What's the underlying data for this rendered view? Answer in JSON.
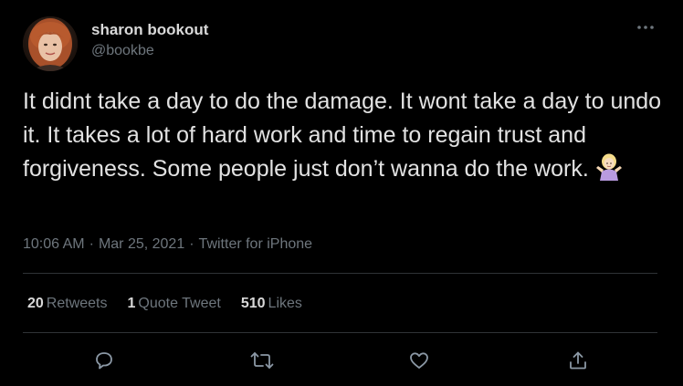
{
  "author": {
    "display_name": "sharon bookout",
    "handle": "@bookbe",
    "avatar_icon": "user-avatar-photo"
  },
  "tweet": {
    "text": "It didnt take a day to do the damage. It wont take a day to undo it. It takes a lot of hard work and time to regain trust and forgiveness. Some people just don’t wanna do the work.",
    "emoji": "person-shrugging-emoji"
  },
  "meta": {
    "time": "10:06 AM",
    "date": "Mar 25, 2021",
    "source": "Twitter for iPhone",
    "separator": "·"
  },
  "stats": {
    "retweets_count": "20",
    "retweets_label": "Retweets",
    "quote_count": "1",
    "quote_label": "Quote Tweet",
    "likes_count": "510",
    "likes_label": "Likes"
  },
  "actions": {
    "reply": "reply-icon",
    "retweet": "retweet-icon",
    "like": "heart-icon",
    "share": "share-icon"
  },
  "colors": {
    "background": "#000000",
    "primary_text": "#d9d9d9",
    "secondary_text": "#6e767d",
    "divider": "#2f3336"
  }
}
